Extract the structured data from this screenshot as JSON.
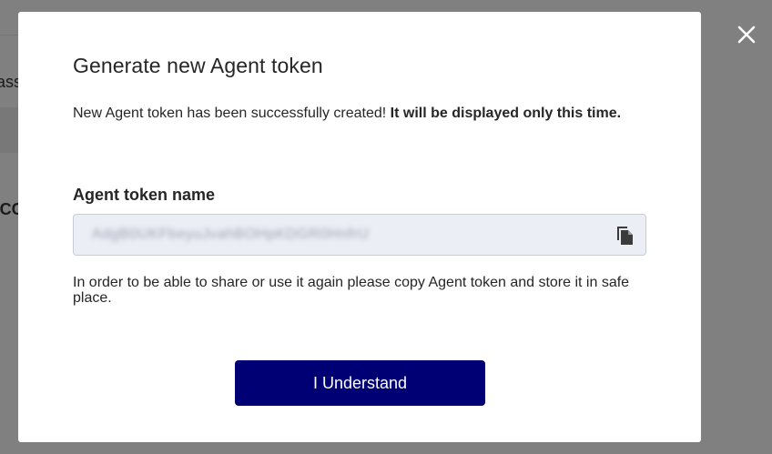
{
  "background": {
    "text_fragment_1": "ass",
    "text_fragment_2": " CC"
  },
  "modal": {
    "title": "Generate new Agent token",
    "message_normal": "New Agent token has been successfully created! ",
    "message_bold": "It will be displayed only this time.",
    "field_label": "Agent token name",
    "token_value": "AdgB0UKFbeyuJvahBOHpKDGR0HnfrU",
    "hint": "In order to be able to share or use it again please copy Agent token and store it in safe place.",
    "confirm_label": "I Understand"
  },
  "icons": {
    "close": "close-icon",
    "copy": "copy-icon"
  },
  "colors": {
    "overlay": "#808080",
    "primary_button": "#000074",
    "token_field_bg": "#eceef6"
  }
}
